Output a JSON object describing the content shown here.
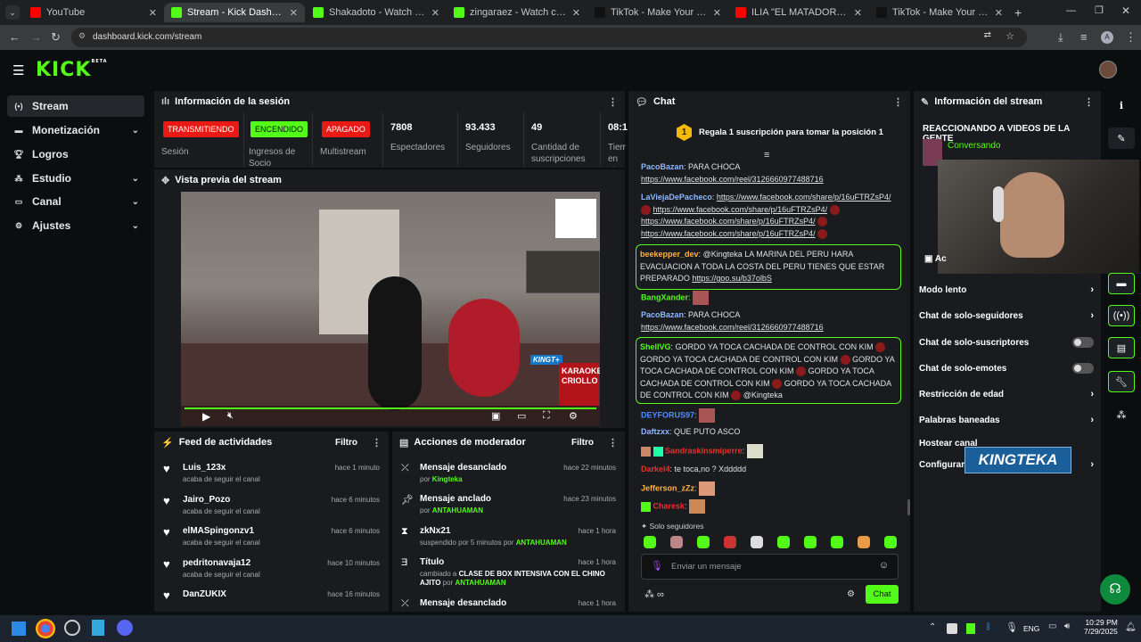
{
  "browser": {
    "tabs": [
      {
        "label": "YouTube",
        "color": "#ff0000"
      },
      {
        "label": "Stream - Kick Dashboard",
        "color": "#53fc18"
      },
      {
        "label": "Shakadoto - Watch clips on Kick",
        "color": "#53fc18"
      },
      {
        "label": "zingaraez - Watch clips on Kick",
        "color": "#53fc18"
      },
      {
        "label": "TikTok - Make Your Day",
        "color": "#111111"
      },
      {
        "label": "ILIA \"EL MATADOR\" TOPURIA -",
        "color": "#ff0000"
      },
      {
        "label": "TikTok - Make Your Day",
        "color": "#111111"
      }
    ],
    "url": "dashboard.kick.com/stream"
  },
  "app": {
    "logo": "KICK",
    "logo_sup": "BETA"
  },
  "sidebar": {
    "items": [
      {
        "label": "Stream",
        "icon": "stream-icon",
        "active": true
      },
      {
        "label": "Monetización",
        "icon": "money-icon",
        "chevron": true
      },
      {
        "label": "Logros",
        "icon": "trophy-icon"
      },
      {
        "label": "Estudio",
        "icon": "studio-icon",
        "chevron": true
      },
      {
        "label": "Canal",
        "icon": "channel-icon",
        "chevron": true
      },
      {
        "label": "Ajustes",
        "icon": "gear-icon",
        "chevron": true
      }
    ]
  },
  "session": {
    "title": "Información de la sesión",
    "badges": [
      {
        "label": "TRANSMITIENDO",
        "caption": "Sesión",
        "color": "#e91916"
      },
      {
        "label": "ENCENDIDO",
        "caption": "Ingresos de Socio",
        "color": "#53fc18"
      },
      {
        "label": "APAGADO",
        "caption": "Multistream",
        "color": "#e91916"
      }
    ],
    "stats": [
      {
        "value": "7808",
        "label": "Espectadores"
      },
      {
        "value": "93.433",
        "label": "Seguidores"
      },
      {
        "value": "49",
        "label": "Cantidad de suscripciones"
      },
      {
        "value": "08:1",
        "label": "Tiem en vi"
      }
    ]
  },
  "preview": {
    "title": "Vista previa del stream",
    "overlay_text": "KARAOKE CRIOLLO",
    "brand_tag": "KINGT+"
  },
  "activity": {
    "title": "Feed de actividades",
    "filter": "Filtro",
    "items": [
      {
        "name": "Luis_123x",
        "sub": "acaba de seguir el canal",
        "time": "hace 1 minuto"
      },
      {
        "name": "Jairo_Pozo",
        "sub": "acaba de seguir el canal",
        "time": "hace 6 minutos"
      },
      {
        "name": "elMASpingonzv1",
        "sub": "acaba de seguir el canal",
        "time": "hace 6 minutos"
      },
      {
        "name": "pedritonavaja12",
        "sub": "acaba de seguir el canal",
        "time": "hace 10 minutos"
      },
      {
        "name": "DanZUKIX",
        "sub": "",
        "time": "hace 16 minutos"
      }
    ]
  },
  "modactions": {
    "title": "Acciones de moderador",
    "filter": "Filtro",
    "items": [
      {
        "title": "Mensaje desanclado",
        "pre": "por ",
        "who": "Kingteka",
        "time": "hace 22 minutos",
        "icon": "unpin-icon"
      },
      {
        "title": "Mensaje anclado",
        "pre": "por ",
        "who": "ANTAHUAMAN",
        "time": "hace 23 minutos",
        "icon": "pin-icon"
      },
      {
        "title": "zkNx21",
        "pre": "suspendido por 5 minutos por ",
        "who": "ANTAHUAMAN",
        "time": "hace 1 hora",
        "icon": "hourglass-icon"
      },
      {
        "title": "Título",
        "pre": "cambiado a ",
        "who": "CLASE DE BOX INTENSIVA CON EL CHINO AJITO",
        "pre2": " por ",
        "who2": "ANTAHUAMAN",
        "time": "hace 1 hora",
        "icon": "title-icon"
      },
      {
        "title": "Mensaje desanclado",
        "pre": "",
        "who": "",
        "time": "hace 1 hora",
        "icon": "unpin-icon"
      }
    ]
  },
  "chat": {
    "title": "Chat",
    "promo": "Regala 1 suscripción para tomar la posición 1",
    "promo_rank": "1",
    "mode_label": "Solo seguidores",
    "input_placeholder": "Enviar un mensaje",
    "send_label": "Chat",
    "messages": {
      "m1_user": "PacoBazan",
      "m1_text": "PARA CHOCA",
      "m1_link": "https://www.facebook.com/reel/3126660977488716",
      "m2_user": "LaViejaDePacheco",
      "m2_l1": "https://www.facebook.com/share/p/16uFTRZsP4/",
      "m2_l2": "https://www.facebook.com/share/p/16uFTRZsP4/",
      "m2_l3": "https://www.facebook.com/share/p/16uFTRZsP4/",
      "m2_l4": "https://www.facebook.com/share/p/16uFTRZsP4/",
      "m3_user": "beekepper_dev",
      "m3_text": "@Kingteka LA MARINA DEL PERU HARA EVACUACION A TODA LA COSTA DEL PERU TIENES QUE ESTAR PREPARADO",
      "m3_link": "https://goo.su/b37olbS",
      "m4_user": "BangXander",
      "m5_user": "PacoBazan",
      "m5_text": "PARA CHOCA",
      "m5_link": "https://www.facebook.com/reel/3126660977488716",
      "m6_user": "ShellVG",
      "m6_text": "GORDO YA TOCA CACHADA DE CONTROL CON KIM",
      "m6_tail": "@Kingteka",
      "m7_user": "DEYFORUS97",
      "m8_user": "Daftzxx",
      "m8_text": "QUE PUTO ASCO",
      "m9_user": "Sandraskinsmiperre",
      "m10_user": "Darkel4",
      "m10_text": "te toca,no ? Xddddd",
      "m11_user": "Jefferson_zZz",
      "m12_user": "Charesk"
    }
  },
  "streaminfo": {
    "title": "Información del stream",
    "stream_title": "REACCIONANDO A VIDEOS DE LA GENTE",
    "category": "Conversando",
    "settings": [
      {
        "label": "Modo lento",
        "kind": "chevron"
      },
      {
        "label": "Chat de solo-seguidores",
        "kind": "chevron"
      },
      {
        "label": "Chat de solo-suscriptores",
        "kind": "toggle"
      },
      {
        "label": "Chat de solo-emotes",
        "kind": "toggle"
      },
      {
        "label": "Restricción de edad",
        "kind": "chevron"
      },
      {
        "label": "Palabras baneadas",
        "kind": "chevron"
      },
      {
        "label": "Hostear canal",
        "kind": "none"
      },
      {
        "label": "Configurar",
        "kind": "chevron"
      }
    ],
    "overlay_logo": "KINGTEKA",
    "section_label": "Ac"
  },
  "taskbar": {
    "lang": "ENG",
    "time": "10:29 PM",
    "date": "7/29/2025"
  }
}
